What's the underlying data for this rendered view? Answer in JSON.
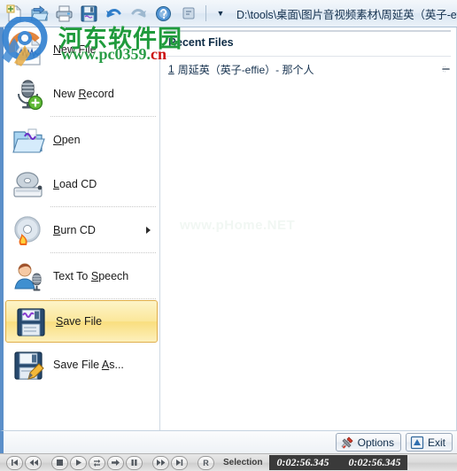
{
  "app": {
    "path_value": "D:\\tools\\桌面\\图片音视频素材\\周延英（英子-effie）"
  },
  "toolbar": {
    "buttons": [
      {
        "name": "new-file-icon",
        "title": "New File"
      },
      {
        "name": "open-icon",
        "title": "Open"
      },
      {
        "name": "print-icon",
        "title": "Print"
      },
      {
        "name": "save-icon",
        "title": "Save"
      },
      {
        "name": "undo-icon",
        "title": "Undo"
      },
      {
        "name": "redo-icon",
        "title": "Redo"
      },
      {
        "name": "help-icon",
        "title": "Help"
      },
      {
        "name": "misc-icon",
        "title": "More"
      }
    ],
    "dropdown_glyph": "▼"
  },
  "menu": {
    "items": [
      {
        "label_pre": "",
        "label_u": "N",
        "label_post": "ew File",
        "icon": "new-file-icon",
        "id": "new-file",
        "separator_after": false,
        "submenu": false,
        "selected": false
      },
      {
        "label_pre": "New ",
        "label_u": "R",
        "label_post": "ecord",
        "icon": "new-record-icon",
        "id": "new-record",
        "separator_after": true,
        "submenu": false,
        "selected": false
      },
      {
        "label_pre": "",
        "label_u": "O",
        "label_post": "pen",
        "icon": "open-folder-icon",
        "id": "open",
        "separator_after": false,
        "submenu": false,
        "selected": false
      },
      {
        "label_pre": "",
        "label_u": "L",
        "label_post": "oad CD",
        "icon": "load-cd-icon",
        "id": "load-cd",
        "separator_after": true,
        "submenu": false,
        "selected": false
      },
      {
        "label_pre": "",
        "label_u": "B",
        "label_post": "urn CD",
        "icon": "burn-cd-icon",
        "id": "burn-cd",
        "separator_after": true,
        "submenu": true,
        "selected": false
      },
      {
        "label_pre": "Text To ",
        "label_u": "S",
        "label_post": "peech",
        "icon": "text-to-speech-icon",
        "id": "text-to-speech",
        "separator_after": true,
        "submenu": false,
        "selected": false
      },
      {
        "label_pre": "",
        "label_u": "S",
        "label_post": "ave File",
        "icon": "save-file-icon",
        "id": "save-file",
        "separator_after": false,
        "submenu": false,
        "selected": true
      },
      {
        "label_pre": "Save File ",
        "label_u": "A",
        "label_post": "s...",
        "icon": "save-file-as-icon",
        "id": "save-file-as",
        "separator_after": false,
        "submenu": false,
        "selected": false
      }
    ]
  },
  "recent": {
    "title": "Recent Files",
    "files": [
      {
        "index": "1",
        "name": "周延英（英子-effie）- 那个人",
        "pinned": false
      }
    ]
  },
  "watermark": {
    "center_text": "www.pHome.NET",
    "brand_cn": "河东软件园",
    "url_prefix": "www.pc0359.",
    "url_suffix": "cn"
  },
  "footer": {
    "options_label": "Options",
    "exit_label": "Exit"
  },
  "transport": {
    "buttons": [
      {
        "id": "skip-to-start",
        "glyph": "◀❙",
        "name": "skip-to-start-button"
      },
      {
        "id": "rewind",
        "glyph": "◀◀",
        "name": "rewind-button"
      },
      {
        "id": "stop",
        "glyph": "■",
        "name": "stop-button"
      },
      {
        "id": "play",
        "glyph": "▶",
        "name": "play-button"
      },
      {
        "id": "loop",
        "glyph": "⇄",
        "name": "loop-button"
      },
      {
        "id": "step-forward",
        "glyph": "➡",
        "name": "step-forward-button"
      },
      {
        "id": "pause",
        "glyph": "❚❚",
        "name": "pause-button"
      },
      {
        "id": "fast-forward",
        "glyph": "▶▶",
        "name": "fast-forward-button"
      },
      {
        "id": "skip-to-end",
        "glyph": "❙▶",
        "name": "skip-to-end-button"
      },
      {
        "id": "record",
        "glyph": "R",
        "name": "record-button"
      }
    ],
    "selection_label": "Selection",
    "selection_start": "0:02:56.345",
    "selection_end": "0:02:56.345"
  },
  "colors": {
    "accent_blue": "#5b8fc9",
    "selected_gold": "#f9de7e",
    "watermark_green": "#1f9b3c",
    "watermark_red": "#cc1111",
    "time_bg": "#3a3a3a"
  }
}
